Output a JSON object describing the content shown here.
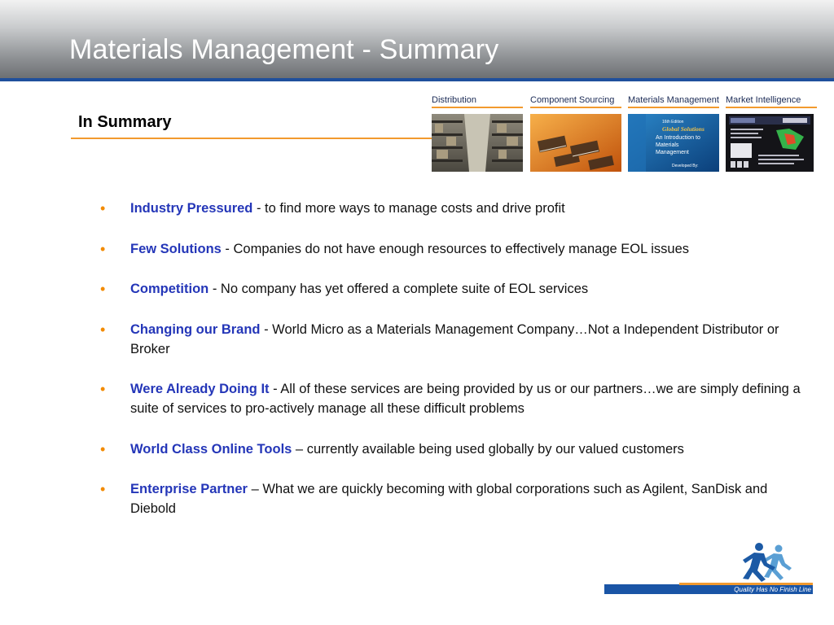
{
  "header": {
    "title": "Materials Management - Summary"
  },
  "section": {
    "heading": "In Summary"
  },
  "banners": [
    {
      "label": "Distribution",
      "image": "warehouse-photo"
    },
    {
      "label": "Component Sourcing",
      "image": "components-photo"
    },
    {
      "label": "Materials Management",
      "image": "book-cover",
      "cover_lines": [
        "16th Edition",
        "Global Solutions",
        "An Introduction to",
        "Materials",
        "Management",
        "Developed By:"
      ]
    },
    {
      "label": "Market Intelligence",
      "image": "newsletter-screenshot"
    }
  ],
  "bullets": [
    {
      "lead": "Industry Pressured",
      "text": " - to find more ways to manage costs and drive profit"
    },
    {
      "lead": "Few Solutions",
      "text": " - Companies do not have enough resources to effectively manage EOL issues"
    },
    {
      "lead": "Competition",
      "text": " - No company has yet offered a complete suite of EOL services"
    },
    {
      "lead": "Changing our Brand",
      "text": " - World Micro as a Materials Management Company…Not a Independent Distributor or Broker"
    },
    {
      "lead": "Were Already Doing It",
      "text": " - All of these services are being provided by us or our partners…we are simply defining a suite of services to pro-actively manage all these difficult problems"
    },
    {
      "lead": "World Class Online Tools",
      "text": " – currently available being used globally by our valued customers"
    },
    {
      "lead": "Enterprise Partner",
      "text": " – What we are quickly becoming with global corporations such as Agilent, SanDisk and Diebold"
    }
  ],
  "footer": {
    "tagline": "Quality Has No Finish Line"
  },
  "colors": {
    "accent_orange": "#f29a2e",
    "title_rule_blue": "#1f4f9c",
    "lead_blue": "#2436b8",
    "bullet_orange": "#f28a00"
  }
}
